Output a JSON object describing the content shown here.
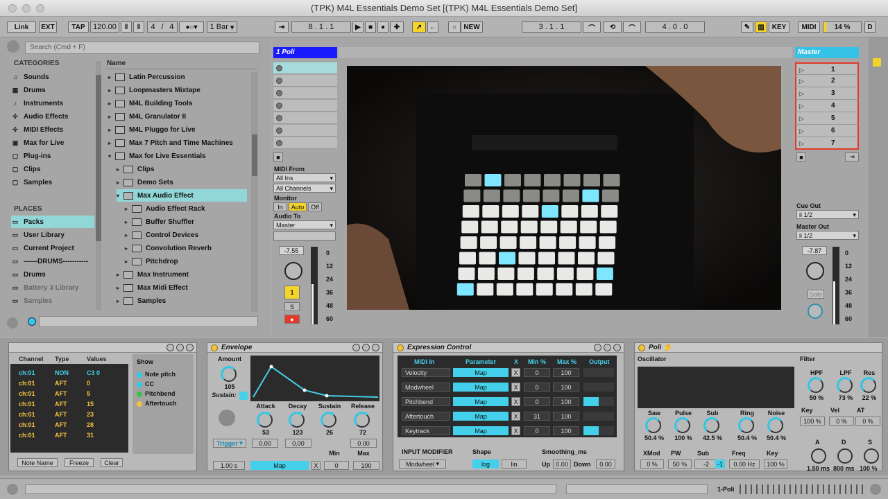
{
  "window": {
    "title": "(TPK) M4L Essentials Demo Set  [(TPK) M4L Essentials Demo Set]"
  },
  "control": {
    "link": "Link",
    "ext": "EXT",
    "tap": "TAP",
    "tempo": "120.00",
    "sig_num": "4",
    "sig_slash": "/",
    "sig_den": "4",
    "quant": "1 Bar",
    "pos": "8 .   1 .   1",
    "new_label": "NEW",
    "loop_start": "3 .   1 .   1",
    "loop_len": "4 .   0 .   0",
    "key": "KEY",
    "midi": "MIDI",
    "cpu": "14 %",
    "d": "D"
  },
  "browser": {
    "search_placeholder": "Search (Cmd + F)",
    "categories_title": "CATEGORIES",
    "categories": [
      "Sounds",
      "Drums",
      "Instruments",
      "Audio Effects",
      "MIDI Effects",
      "Max for Live",
      "Plug-ins",
      "Clips",
      "Samples"
    ],
    "places_title": "PLACES",
    "places": [
      "Packs",
      "User Library",
      "Current Project",
      "------DRUMS-----------",
      "Drums",
      "Battery 3 Library",
      "Samples"
    ],
    "name_header": "Name",
    "files": [
      {
        "name": "Latin Percussion",
        "d": 0
      },
      {
        "name": "Loopmasters Mixtape",
        "d": 0
      },
      {
        "name": "M4L Building Tools",
        "d": 0
      },
      {
        "name": "M4L Granulator II",
        "d": 0
      },
      {
        "name": "M4L Pluggo for Live",
        "d": 0
      },
      {
        "name": "Max 7 Pitch and Time Machines",
        "d": 0
      },
      {
        "name": "Max for Live Essentials",
        "d": 0
      },
      {
        "name": "Clips",
        "d": 1
      },
      {
        "name": "Demo Sets",
        "d": 1
      },
      {
        "name": "Max Audio Effect",
        "d": 1
      },
      {
        "name": "Audio Effect Rack",
        "d": 2
      },
      {
        "name": "Buffer Shuffler",
        "d": 2
      },
      {
        "name": "Control Devices",
        "d": 2
      },
      {
        "name": "Convolution Reverb",
        "d": 2
      },
      {
        "name": "Pitchdrop",
        "d": 2
      },
      {
        "name": "Max Instrument",
        "d": 1
      },
      {
        "name": "Max Midi Effect",
        "d": 1
      },
      {
        "name": "Samples",
        "d": 1
      }
    ]
  },
  "track": {
    "name": "1 Poli",
    "color": "#1a1aff",
    "midi_from": "MIDI From",
    "all_ins": "All Ins",
    "all_channels": "All Channels",
    "monitor": "Monitor",
    "in": "In",
    "auto": "Auto",
    "off": "Off",
    "audio_to": "Audio To",
    "master": "Master",
    "vol": "-7.55",
    "num": "1",
    "s": "S",
    "meter": [
      "0",
      "12",
      "24",
      "36",
      "48",
      "60"
    ]
  },
  "master": {
    "name": "Master",
    "color": "#36c2e6",
    "scenes": [
      "1",
      "2",
      "3",
      "4",
      "5",
      "6",
      "7"
    ],
    "cue_out": "Cue Out",
    "cue_val": "ii 1/2",
    "master_out": "Master Out",
    "master_val": "ii 1/2",
    "vol": "-7.87",
    "solo": "Solo",
    "meter": [
      "0",
      "12",
      "24",
      "36",
      "48",
      "60"
    ]
  },
  "midimon": {
    "headers": [
      "Channel",
      "Type",
      "Values"
    ],
    "rows": [
      [
        "ch:01",
        "NON",
        "C3  0"
      ],
      [
        "ch:01",
        "AFT",
        "0"
      ],
      [
        "ch:01",
        "AFT",
        "5"
      ],
      [
        "ch:01",
        "AFT",
        "15"
      ],
      [
        "ch:01",
        "AFT",
        "23"
      ],
      [
        "ch:01",
        "AFT",
        "28"
      ],
      [
        "ch:01",
        "AFT",
        "31"
      ]
    ],
    "show": "Show",
    "opts": [
      "Note pitch",
      "CC",
      "Pitchbend",
      "Aftertouch"
    ],
    "opt_colors": [
      "#33c9e6",
      "#33c9e6",
      "#3cbf4a",
      "#f2c23e"
    ],
    "btns": [
      "Note Name",
      "Freeze",
      "Clear"
    ]
  },
  "envelope": {
    "title": "Envelope",
    "amount": "Amount",
    "amount_val": "105",
    "sustain": "Sustain:",
    "attack": "Attack",
    "decay": "Decay",
    "sus": "Sustain",
    "release": "Release",
    "a_val": "53",
    "d_val": "123",
    "s_val": "26",
    "r_val": "72",
    "trigger": "Trigger",
    "z1": "0.00",
    "z2": "0.00",
    "z3": "0.00",
    "time": "1.00 s",
    "map": "Map",
    "x": "X",
    "min": "Min",
    "max": "Max",
    "min_val": "0",
    "max_val": "100"
  },
  "expression": {
    "title": "Expression Control",
    "headers": [
      "MIDI In",
      "Parameter",
      "X",
      "Min %",
      "Max %",
      "Output"
    ],
    "rows": [
      {
        "name": "Velocity",
        "min": "0",
        "max": "100",
        "out": 0
      },
      {
        "name": "Modwheel",
        "min": "0",
        "max": "100",
        "out": 0
      },
      {
        "name": "Pitchbend",
        "min": "0",
        "max": "100",
        "out": 0.5
      },
      {
        "name": "Aftertouch",
        "min": "31",
        "max": "100",
        "out": 0
      },
      {
        "name": "Keytrack",
        "min": "0",
        "max": "100",
        "out": 0.5
      }
    ],
    "map": "Map",
    "x": "X",
    "input_mod": "INPUT MODIFIER",
    "modwheel": "Modwheel",
    "shape": "Shape",
    "log": "log",
    "lin": "lin",
    "smoothing": "Smoothing_ms",
    "up": "Up",
    "up_val": "0.00",
    "down": "Down",
    "down_val": "0.00"
  },
  "poli": {
    "title": "Poli",
    "oscillator": "Oscillator",
    "filter": "Filter",
    "saw": "Saw",
    "pulse": "Pulse",
    "sub": "Sub",
    "ring": "Ring",
    "noise": "Noise",
    "saw_v": "50.4 %",
    "pulse_v": "100 %",
    "sub_v": "42.5 %",
    "ring_v": "50.4 %",
    "noise_v": "50.4 %",
    "hpf": "HPF",
    "lpf": "LPF",
    "res": "Res",
    "hpf_v": "50 %",
    "lpf_v": "73 %",
    "res_v": "22 %",
    "key": "Key",
    "vel": "Vel",
    "at": "AT",
    "key_v": "100 %",
    "vel_v": "0 %",
    "at_v": "0 %",
    "xmod": "XMod",
    "pw": "PW",
    "sub2": "Sub",
    "freq": "Freq",
    "key2": "Key",
    "xmod_v": "0 %",
    "pw_v": "50 %",
    "sub2_v": "-2",
    "sub2_v2": "-1",
    "freq_v": "0.00 Hz",
    "key2_v": "100 %",
    "a": "A",
    "d": "D",
    "s": "S",
    "a_v": "1.50 ms",
    "d_v": "800 ms",
    "s_v": "100 %"
  },
  "status": {
    "track": "1-Poli"
  }
}
